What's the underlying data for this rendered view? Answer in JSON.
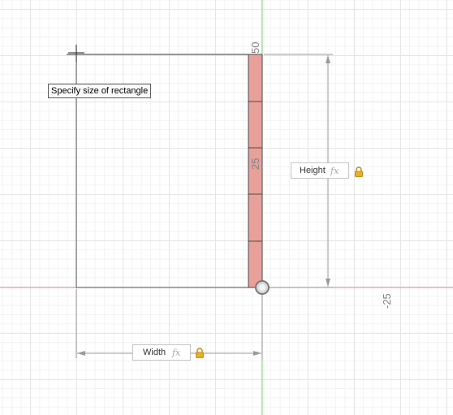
{
  "tooltip": "Specify size of rectangle",
  "axis_ticks": {
    "top": "50",
    "mid": "25",
    "right": "-25"
  },
  "width_input": {
    "value": "Width",
    "fx": "fx",
    "locked": true
  },
  "height_input": {
    "value": "Height",
    "fx": "fx",
    "locked": true
  },
  "colors": {
    "x_axis": "#e88c8c",
    "y_axis": "#7ed67e",
    "profile_fill": "#e8a09b",
    "lock": "#e8b020"
  }
}
